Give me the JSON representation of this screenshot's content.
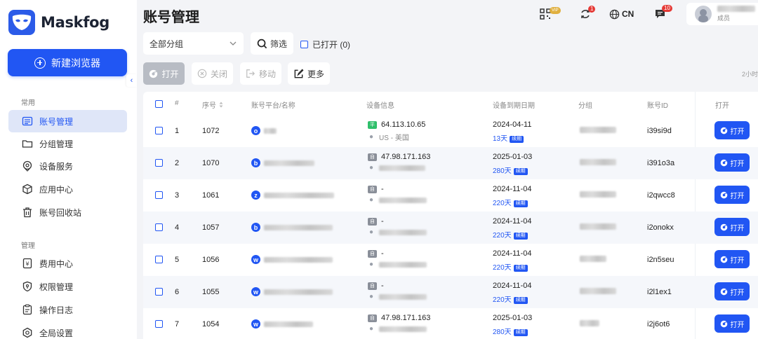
{
  "app": {
    "name": "Maskfog",
    "brand_color": "#2156f3"
  },
  "sidebar": {
    "new_button": "新建浏览器",
    "section_common": "常用",
    "section_manage": "管理",
    "common_items": [
      {
        "label": "账号管理",
        "icon": "profile-list-icon",
        "active": true
      },
      {
        "label": "分组管理",
        "icon": "folder-icon"
      },
      {
        "label": "设备服务",
        "icon": "location-icon"
      },
      {
        "label": "应用中心",
        "icon": "cube-icon"
      },
      {
        "label": "账号回收站",
        "icon": "trash-icon"
      }
    ],
    "manage_items": [
      {
        "label": "费用中心",
        "icon": "billing-icon"
      },
      {
        "label": "权限管理",
        "icon": "shield-icon"
      },
      {
        "label": "操作日志",
        "icon": "clipboard-icon"
      },
      {
        "label": "全局设置",
        "icon": "settings-icon"
      }
    ]
  },
  "header": {
    "title": "账号管理",
    "vip_badge": "VIP",
    "sync_badge": "1",
    "language": "CN",
    "message_badge": "10",
    "user_role": "成员"
  },
  "filters": {
    "group_select": "全部分组",
    "filter_button": "筛选",
    "opened_checkbox": "已打开 (0)"
  },
  "toolbar": {
    "open": "打开",
    "close": "关闭",
    "move": "移动",
    "more": "更多",
    "right_hint": "2小时"
  },
  "table": {
    "columns": [
      "#",
      "序号",
      "账号平台/名称",
      "设备信息",
      "设备到期日期",
      "分组",
      "账号ID",
      "打开"
    ],
    "renew_label": "续期",
    "open_label": "打开",
    "rows": [
      {
        "idx": "1",
        "serial": "1072",
        "platform": "o",
        "ip_type": "平",
        "ip": "64.113.10.65",
        "location": "US - 美国",
        "expiry": "2024-04-11",
        "days": "13天",
        "account_id": "i39si9d"
      },
      {
        "idx": "2",
        "serial": "1070",
        "platform": "b",
        "ip_type": "自",
        "ip": "47.98.171.163",
        "location": "",
        "expiry": "2025-01-03",
        "days": "280天",
        "account_id": "i391o3a"
      },
      {
        "idx": "3",
        "serial": "1061",
        "platform": "z",
        "ip_type": "自",
        "ip": "-",
        "location": "",
        "expiry": "2024-11-04",
        "days": "220天",
        "account_id": "i2qwcc8"
      },
      {
        "idx": "4",
        "serial": "1057",
        "platform": "b",
        "ip_type": "自",
        "ip": "-",
        "location": "",
        "expiry": "2024-11-04",
        "days": "220天",
        "account_id": "i2onokx"
      },
      {
        "idx": "5",
        "serial": "1056",
        "platform": "w",
        "ip_type": "自",
        "ip": "-",
        "location": "",
        "expiry": "2024-11-04",
        "days": "220天",
        "account_id": "i2n5seu"
      },
      {
        "idx": "6",
        "serial": "1055",
        "platform": "w",
        "ip_type": "自",
        "ip": "-",
        "location": "",
        "expiry": "2024-11-04",
        "days": "220天",
        "account_id": "i2l1ex1"
      },
      {
        "idx": "7",
        "serial": "1054",
        "platform": "w",
        "ip_type": "自",
        "ip": "47.98.171.163",
        "location": "",
        "expiry": "2025-01-03",
        "days": "280天",
        "account_id": "i2j6ot6"
      }
    ]
  }
}
